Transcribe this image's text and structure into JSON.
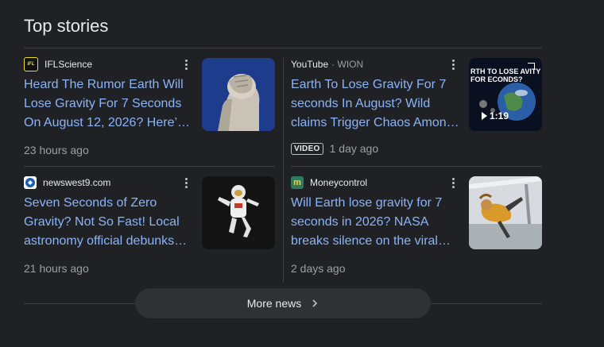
{
  "section_title": "Top stories",
  "stories": [
    {
      "source": "IFLScience",
      "source_sub": "",
      "favicon_text": "IFL",
      "headline": "Heard The Rumor Earth Will Lose Gravity For 7 Seconds On August 12, 2026? Here’…",
      "time": "23 hours ago",
      "badge": "",
      "duration": ""
    },
    {
      "source": "YouTube",
      "source_sub": "· WION",
      "favicon_text": "",
      "headline": "Earth To Lose Gravity For 7 seconds In August? Wild claims Trigger Chaos Amon…",
      "time": "1 day ago",
      "badge": "VIDEO",
      "duration": "1:19",
      "thumb_text": "RTH TO LOSE AVITY FOR ECONDS?"
    },
    {
      "source": "newswest9.com",
      "source_sub": "",
      "favicon_text": "",
      "headline": "Seven Seconds of Zero Gravity? Not So Fast! Local astronomy official debunks…",
      "time": "21 hours ago",
      "badge": "",
      "duration": ""
    },
    {
      "source": "Moneycontrol",
      "source_sub": "",
      "favicon_text": "m",
      "headline": "Will Earth lose gravity for 7 seconds in 2026? NASA breaks silence on the viral…",
      "time": "2 days ago",
      "badge": "",
      "duration": ""
    }
  ],
  "more_news_label": "More news",
  "colors": {
    "background": "#202124",
    "headline": "#8ab4f8",
    "meta": "#9aa0a6",
    "button_bg": "#303134"
  }
}
